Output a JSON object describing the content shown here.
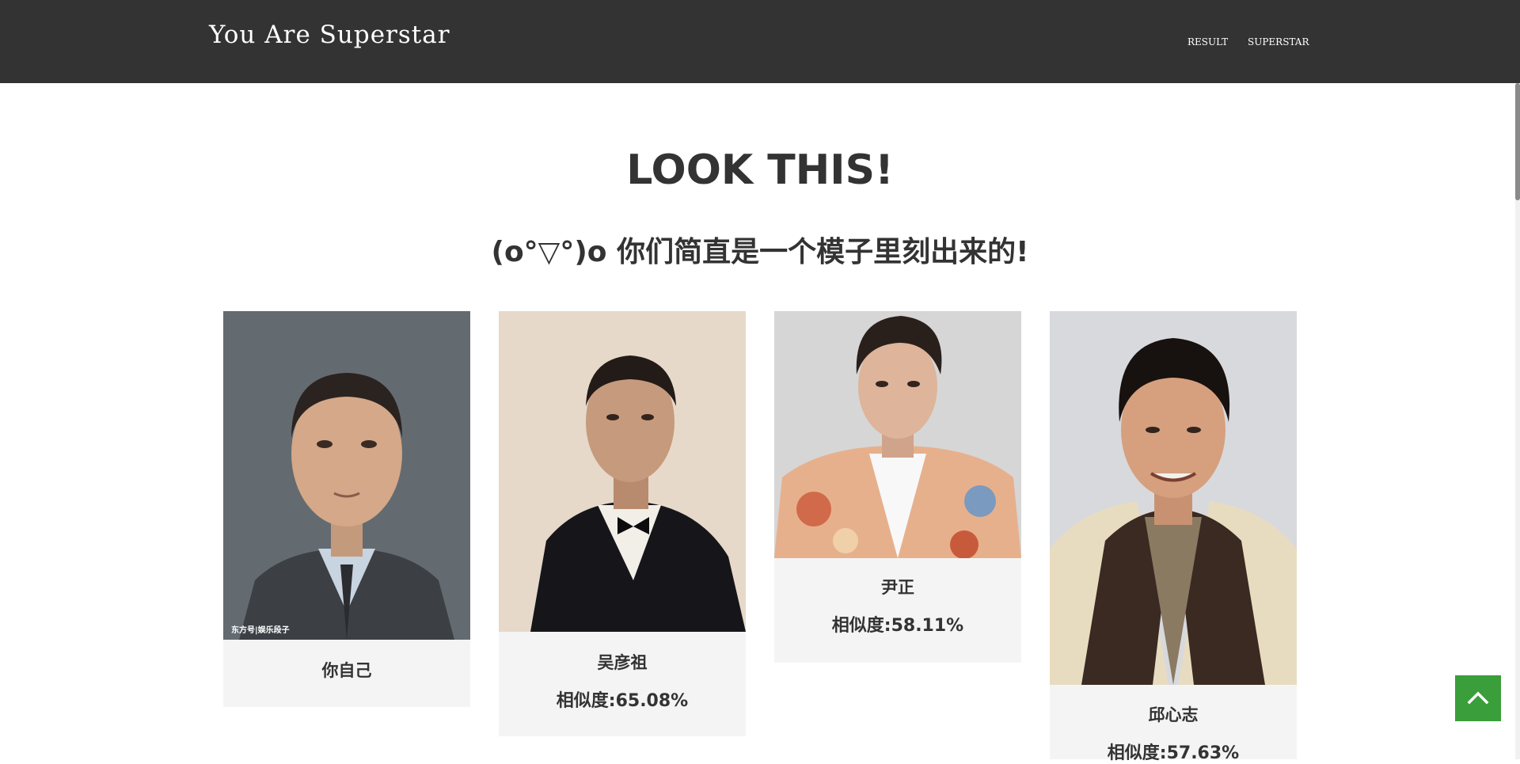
{
  "navbar": {
    "brand": "You Are Superstar",
    "links": [
      "RESULT",
      "SUPERSTAR"
    ]
  },
  "main": {
    "heading": "LOOK THIS!",
    "subheading": "(o°▽°)o 你们简直是一个模子里刻出来的!"
  },
  "cards": [
    {
      "name": "你自己",
      "similarity": "",
      "watermark": "东方号|娱乐段子"
    },
    {
      "name": "吴彦祖",
      "similarity": "相似度:65.08%"
    },
    {
      "name": "尹正",
      "similarity": "相似度:58.11%"
    },
    {
      "name": "邱心志",
      "similarity": "相似度:57.63%"
    }
  ],
  "colors": {
    "navbar_bg": "#333333",
    "card_bg": "#f4f4f4",
    "back_to_top": "#3a9e3a",
    "text": "#333333"
  },
  "icons": {
    "back_to_top": "chevron-up-icon"
  }
}
